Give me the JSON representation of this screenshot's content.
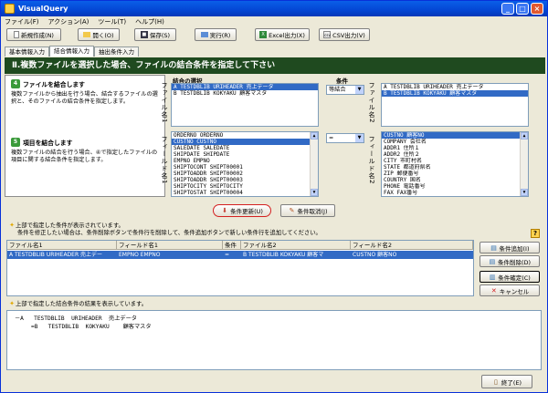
{
  "window": {
    "title": "VisualQuery"
  },
  "menu": [
    "ファイル(F)",
    "アクション(A)",
    "ツール(T)",
    "ヘルプ(H)"
  ],
  "toolbar": {
    "new": "新規作成(N)",
    "open": "開く(O)",
    "save": "保存(S)",
    "run": "実行(R)",
    "excel": "Excel出力(X)",
    "csv": "CSV出力(V)"
  },
  "tabs": [
    "基本情報入力",
    "結合情報入力",
    "抽出条件入力"
  ],
  "banner": "Ⅱ.複数ファイルを選択した場合、ファイルの結合条件を指定して下さい",
  "left": {
    "sec1_num": "4",
    "sec1_title": "ファイルを結合します",
    "sec1_text": "複数ファイルから抽出を行う場合、結合するファイルの選択と、そのファイルの結合条件を指定します。",
    "sec2_num": "5",
    "sec2_title": "項目を結合します",
    "sec2_text": "複数ファイルの結合を行う場合、④で指定したファイルの項目に関する結合条件を指定します。"
  },
  "labels": {
    "file1": "ファイル名1",
    "field1": "フィールド名1",
    "file2": "ファイル名2",
    "field2": "フィールド名2",
    "join_select": "結合の選択",
    "condition": "条件"
  },
  "file1_list": [
    "A   TESTDBLIB URIHEADER 売上データ",
    "B   TESTDBLIB KOKYAKU   顧客マスタ"
  ],
  "file2_list": [
    "A   TESTDBLIB URIHEADER 売上データ",
    "B   TESTDBLIB KOKYAKU   顧客マスタ"
  ],
  "join_combo": "等結合",
  "cond_combo": "=",
  "field1_list": [
    "ORDERNO   ORDERNO",
    "CUSTNO    CUSTNO",
    "SALEDATE  SALEDATE",
    "SHIPDATE  SHIPDATE",
    "EMPNO     EMPNO",
    "SHIPTOCONT SHIPT00001",
    "SHIPTOADDR SHIPT00002",
    "SHIPTOADDR SHIPT00003",
    "SHIPTOCITY SHIPTOCITY",
    "SHIPTOSTAT SHIPT00004"
  ],
  "field2_list": [
    "CUSTNO     顧客NO",
    "COMPANY    会社名",
    "ADDR1      住所１",
    "ADDR2      住所２",
    "CITY       市町村名",
    "STATE      都道府県名",
    "ZIP        郵便番号",
    "COUNTRY    国名",
    "PHONE      電話番号",
    "FAX        FAX番号"
  ],
  "buttons": {
    "update": "条件更新(U)",
    "cancel_cond": "条件取消(J)",
    "add": "条件追加(I)",
    "delete": "条件削除(D)",
    "confirm": "条件確定(C)",
    "cancel": "キャンセル",
    "exit": "終了(E)"
  },
  "info1": {
    "line1": "上部で指定した条件が表示されています。",
    "line2": "条件を修正したい場合は、条件削除ボタンで条件行を削除して、条件追加ボタンで新しい条件行を追加してください。"
  },
  "grid": {
    "headers": [
      "ファイル名1",
      "フィールド名1",
      "条件",
      "ファイル名2",
      "フィールド名2"
    ],
    "row": [
      "A   TESTDBLIB  URIHEADER  売上デー",
      "EMPNO       EMPNO",
      "=",
      "B   TESTDBLIB  KOKYAKU   顧客マ",
      "CUSTNO      顧客NO"
    ]
  },
  "info2": "上部で指定した結合条件の結果を表示しています。",
  "tree": [
    "－A   TESTDBLIB  URIHEADER  売上データ",
    "=B   TESTDBLIB  KOKYAKU    顧客マスタ"
  ]
}
